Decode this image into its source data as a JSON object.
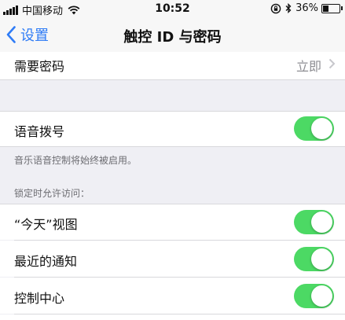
{
  "status_bar": {
    "carrier": "中国移动",
    "time": "10:52",
    "battery_percent": "36%",
    "battery_level": 0.36,
    "bluetooth_glyph": "∦"
  },
  "nav": {
    "back_label": "设置",
    "title": "触控 ID 与密码"
  },
  "require_passcode": {
    "label": "需要密码",
    "value": "立即"
  },
  "voice_dial": {
    "label": "语音拨号",
    "on": true,
    "footer": "音乐语音控制将始终被启用。"
  },
  "allow_access": {
    "header": "锁定时允许访问：",
    "items": [
      {
        "label": "“今天”视图",
        "on": true
      },
      {
        "label": "最近的通知",
        "on": true
      },
      {
        "label": "控制中心",
        "on": true
      }
    ]
  },
  "colors": {
    "accent": "#2f7cf6",
    "toggle_on": "#4cd964",
    "background": "#efeff4"
  },
  "icons": [
    "signal-icon",
    "wifi-icon",
    "rotation-lock-icon",
    "bluetooth-icon",
    "battery-icon",
    "back-chevron-icon",
    "chevron-right-icon"
  ]
}
